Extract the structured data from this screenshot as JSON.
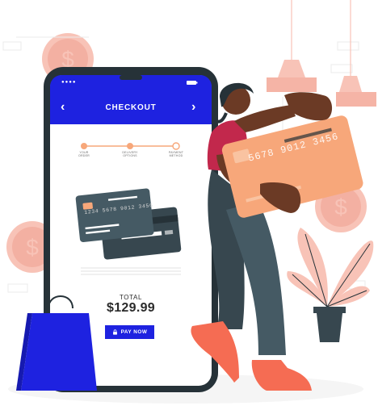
{
  "checkout": {
    "title": "CHECKOUT",
    "back_icon": "chevron-left-icon",
    "forward_icon": "chevron-right-icon"
  },
  "steps": [
    {
      "label": "YOUR\nORDER",
      "state": "done"
    },
    {
      "label": "DELIVERY\nOPTIONS",
      "state": "done"
    },
    {
      "label": "PAYMENT\nMETHOD",
      "state": "current"
    }
  ],
  "card": {
    "number": "1234 5678 9012 3456"
  },
  "big_card": {
    "number": "5678 9012 3456"
  },
  "total": {
    "label": "TOTAL",
    "amount": "$129.99"
  },
  "pay_button": {
    "label": "PAY NOW",
    "icon": "lock-icon"
  },
  "colors": {
    "accent_blue": "#1e22e0",
    "phone_dark": "#263238",
    "card_orange": "#f7a77a",
    "coral": "#f56c53",
    "pink_deco": "#f8c3b7",
    "shirt": "#c2284c"
  }
}
